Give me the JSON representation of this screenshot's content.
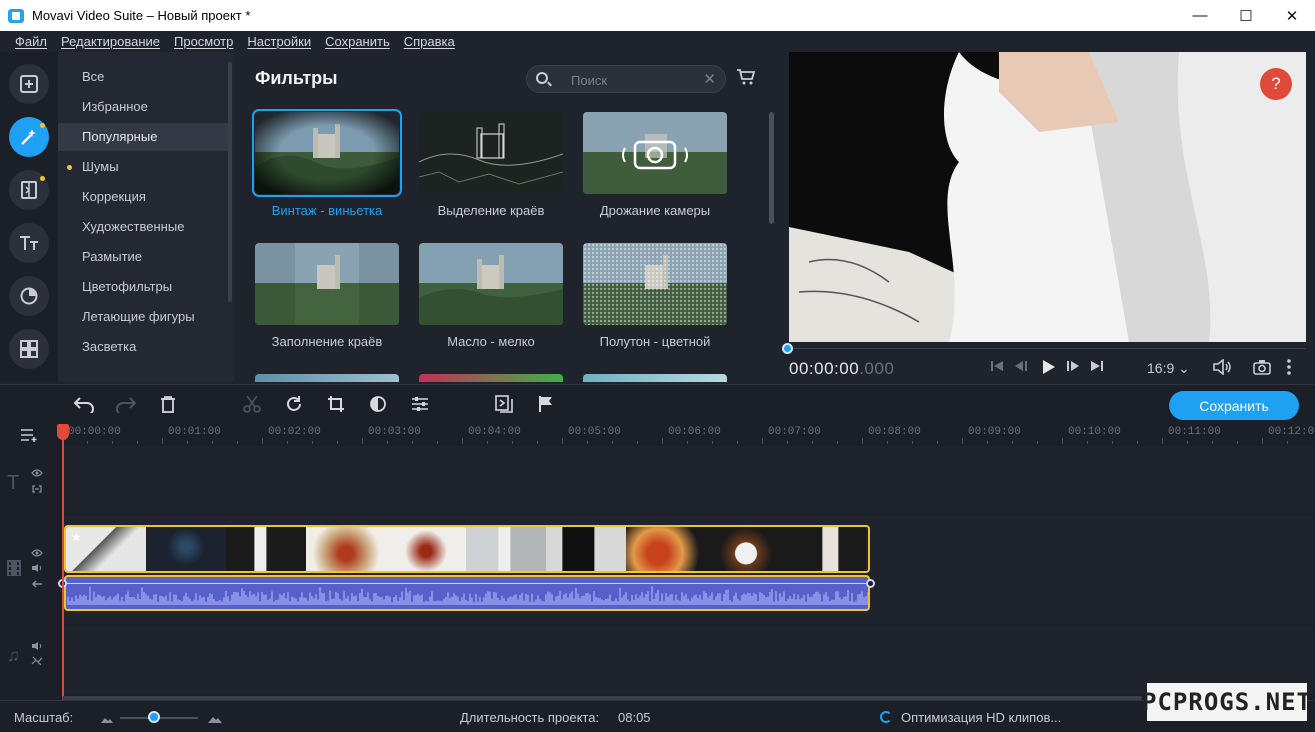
{
  "window": {
    "title": "Movavi Video Suite – Новый проект *",
    "minimize": "—",
    "maximize": "☐",
    "close": "✕"
  },
  "menu": [
    "Файл",
    "Редактирование",
    "Просмотр",
    "Настройки",
    "Сохранить",
    "Справка"
  ],
  "rail_icons": [
    "add-media-icon",
    "magic-wand-icon",
    "transitions-icon",
    "titles-icon",
    "stickers-icon",
    "more-tools-icon"
  ],
  "categories": [
    {
      "label": "Все",
      "dot": false,
      "selected": false
    },
    {
      "label": "Избранное",
      "dot": false,
      "selected": false
    },
    {
      "label": "Популярные",
      "dot": false,
      "selected": true
    },
    {
      "label": "Шумы",
      "dot": true,
      "selected": false
    },
    {
      "label": "Коррекция",
      "dot": false,
      "selected": false
    },
    {
      "label": "Художественные",
      "dot": false,
      "selected": false
    },
    {
      "label": "Размытие",
      "dot": false,
      "selected": false
    },
    {
      "label": "Цветофильтры",
      "dot": false,
      "selected": false
    },
    {
      "label": "Летающие фигуры",
      "dot": false,
      "selected": false
    },
    {
      "label": "Засветка",
      "dot": false,
      "selected": false
    }
  ],
  "filters": {
    "title": "Фильтры",
    "search_placeholder": "Поиск",
    "items": [
      {
        "label": "Винтаж - виньетка",
        "selected": true,
        "style": "vintage"
      },
      {
        "label": "Выделение краёв",
        "selected": false,
        "style": "edges"
      },
      {
        "label": "Дрожание камеры",
        "selected": false,
        "style": "shake"
      },
      {
        "label": "Заполнение краёв",
        "selected": false,
        "style": "fill"
      },
      {
        "label": "Масло - мелко",
        "selected": false,
        "style": "oil"
      },
      {
        "label": "Полутон - цветной",
        "selected": false,
        "style": "halftone"
      }
    ]
  },
  "preview": {
    "timecode": "00:00:00",
    "timecode_ms": ".000",
    "aspect": "16:9",
    "help": "?"
  },
  "toolbar": {
    "save_label": "Сохранить"
  },
  "timeline": {
    "ticks": [
      "00:00:00",
      "00:01:00",
      "00:02:00",
      "00:03:00",
      "00:04:00",
      "00:05:00",
      "00:06:00",
      "00:07:00",
      "00:08:00",
      "00:09:00",
      "00:10:00",
      "00:11:00",
      "00:12:0"
    ]
  },
  "status": {
    "scale_label": "Масштаб:",
    "duration_label": "Длительность проекта:",
    "duration": "08:05",
    "optimization": "Оптимизация HD клипов..."
  },
  "watermark": "PCPROGS.NET",
  "colors": {
    "accent": "#1ea1f2",
    "clip_border": "#f2c230",
    "playhead": "#e04a3a",
    "audio": "#5560c8"
  }
}
